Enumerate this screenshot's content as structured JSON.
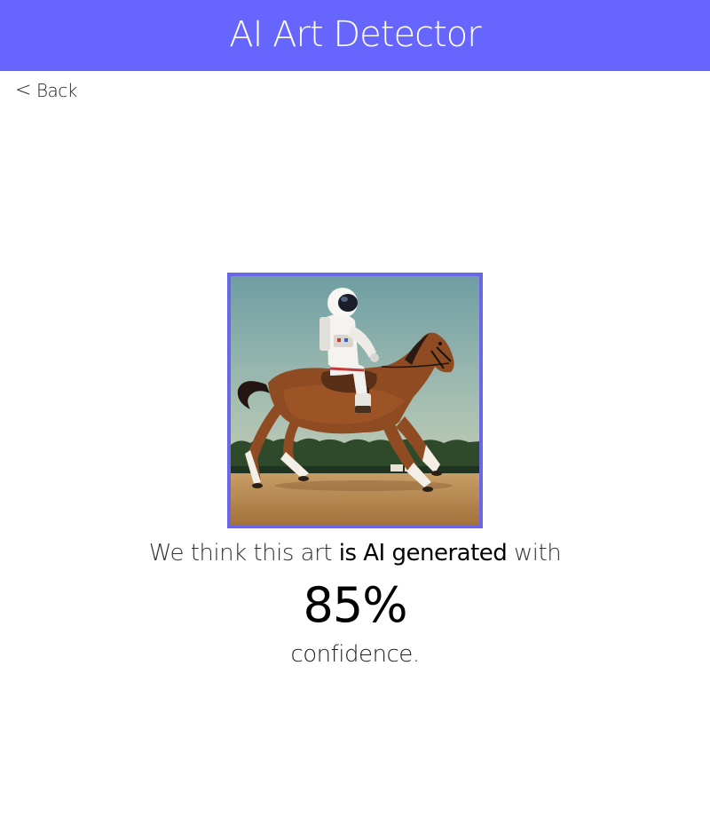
{
  "app": {
    "title": "AI Art Detector"
  },
  "nav": {
    "back_label": "Back",
    "back_icon": "chevron-left-icon"
  },
  "result": {
    "prefix": "We think this art",
    "verdict": "is AI generated",
    "suffix": "with",
    "confidence_value": "85%",
    "confidence_label": "confidence.",
    "confidence_fraction": 0.85
  },
  "image": {
    "subject": "astronaut riding a horse",
    "frame_color": "#6a66e8"
  },
  "colors": {
    "header_bg": "#6666ff",
    "header_text": "#ffffff",
    "body_text": "#222222"
  }
}
